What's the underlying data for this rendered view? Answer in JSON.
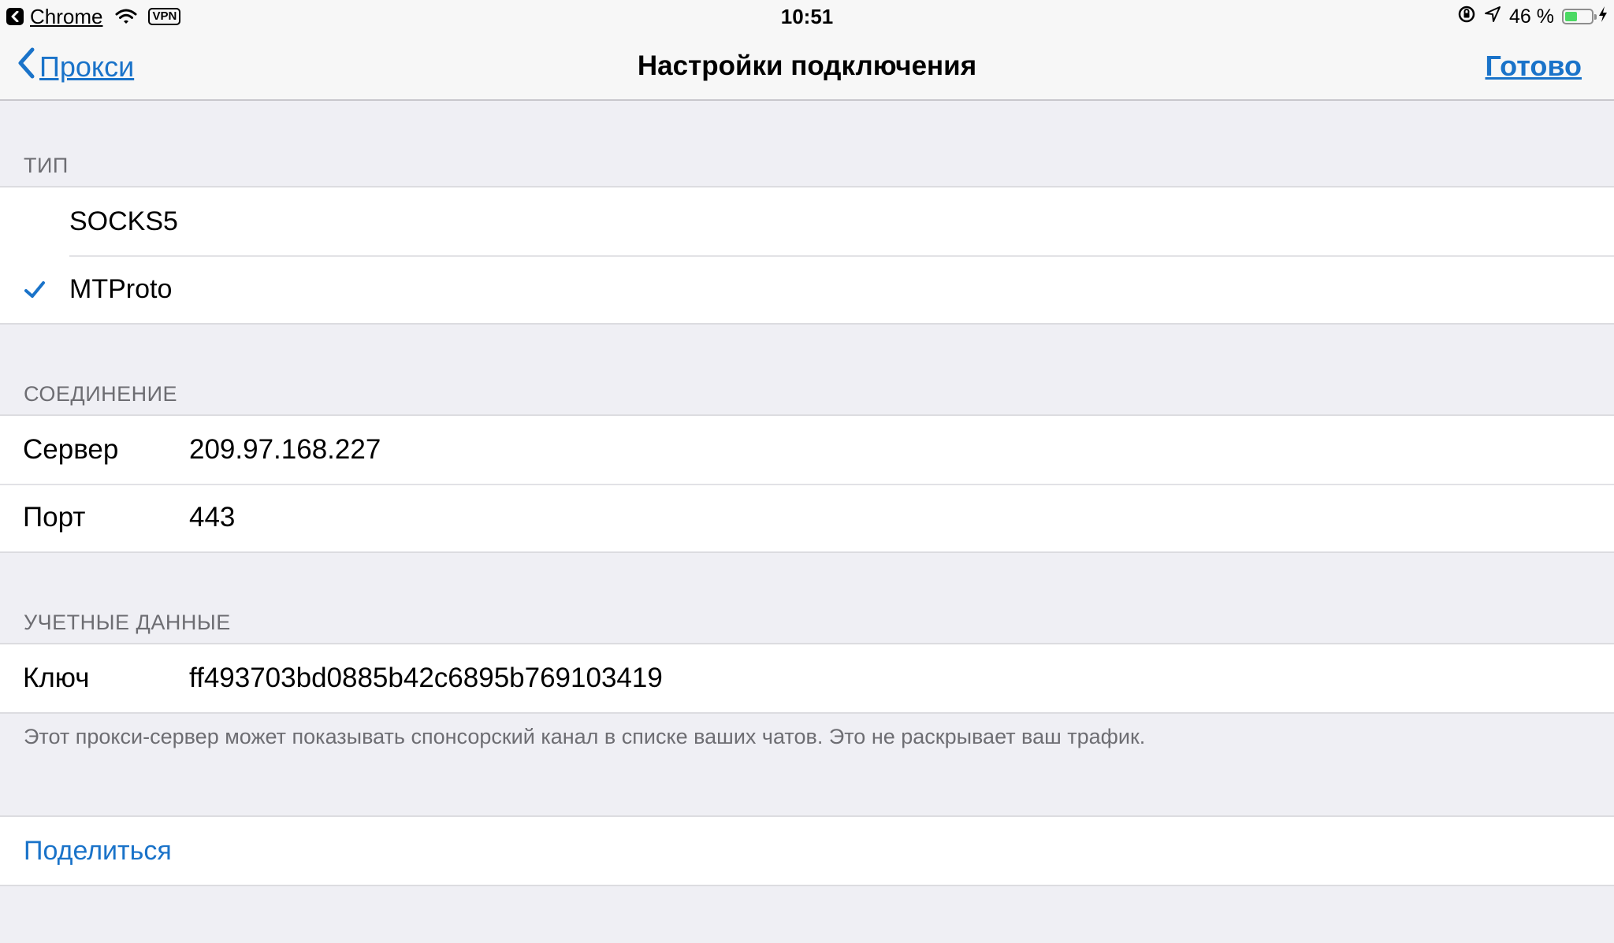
{
  "status_bar": {
    "back_app": "Chrome",
    "vpn": "VPN",
    "time": "10:51",
    "battery_percent_label": "46 %",
    "battery_level": 0.46,
    "battery_color": "#4cd964"
  },
  "nav": {
    "back_label": "Прокси",
    "title": "Настройки подключения",
    "done_label": "Готово",
    "accent_color": "#1a73c9"
  },
  "type_section": {
    "header": "ТИП",
    "options": [
      {
        "label": "SOCKS5",
        "selected": false
      },
      {
        "label": "MTProto",
        "selected": true
      }
    ]
  },
  "connection_section": {
    "header": "СОЕДИНЕНИЕ",
    "fields": [
      {
        "label": "Сервер",
        "value": "209.97.168.227"
      },
      {
        "label": "Порт",
        "value": "443"
      }
    ]
  },
  "credentials_section": {
    "header": "УЧЕТНЫЕ ДАННЫЕ",
    "fields": [
      {
        "label": "Ключ",
        "value": "ff493703bd0885b42c6895b769103419"
      }
    ],
    "footer": "Этот прокси-сервер может показывать спонсорский канал в списке ваших чатов. Это не раскрывает ваш трафик."
  },
  "share": {
    "label": "Поделиться"
  },
  "icons": {
    "back_app": "chevron-left-icon",
    "wifi": "wifi-icon",
    "orientation_lock": "orientation-lock-icon",
    "location": "location-arrow-icon",
    "battery": "battery-icon",
    "charging": "charging-bolt-icon",
    "nav_back": "chevron-left-icon",
    "selected": "checkmark-icon"
  }
}
